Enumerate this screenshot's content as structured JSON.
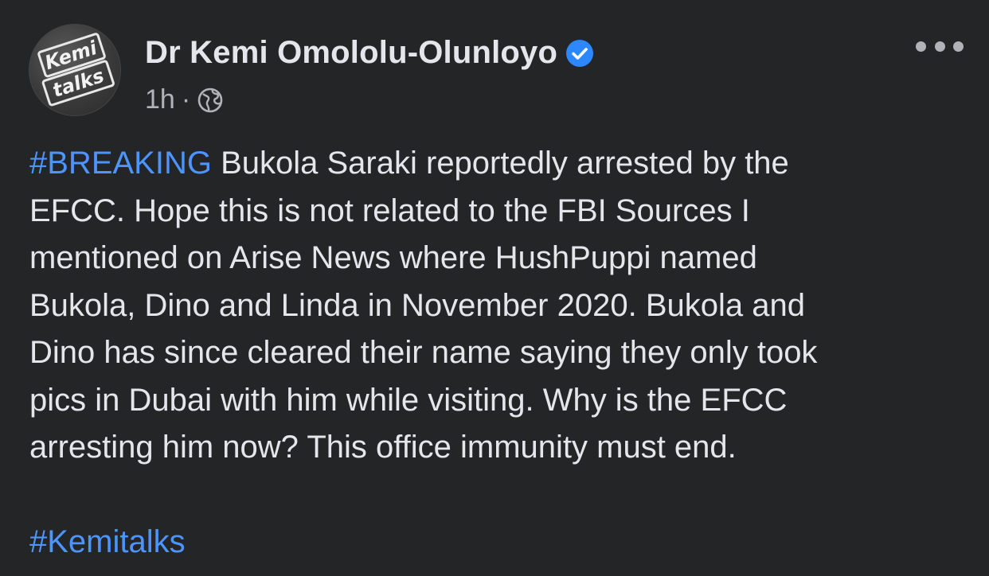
{
  "post": {
    "author": {
      "name": "Dr Kemi Omololu-Olunloyo",
      "verified": true,
      "avatar_text_line1": "Kemi",
      "avatar_text_line2": "talks"
    },
    "timestamp": "1h",
    "separator": "·",
    "audience_icon": "globe-icon",
    "more_icon": "more-options-icon",
    "body": {
      "lines": [
        {
          "hashtag": "#BREAKING",
          "text": " Bukola Saraki reportedly arrested by the"
        },
        {
          "text": "EFCC. Hope this is not related to the FBI Sources I"
        },
        {
          "text": "mentioned on Arise News where HushPuppi named"
        },
        {
          "text": "Bukola, Dino and Linda in November 2020. Bukola and"
        },
        {
          "text": "Dino has since cleared their name saying they only took"
        },
        {
          "text": "pics in Dubai with him while visiting. Why is the EFCC"
        },
        {
          "text": "arresting him now? This office immunity must end."
        }
      ],
      "footer_hashtag": "#Kemitalks"
    }
  },
  "colors": {
    "background": "#242526",
    "text_primary": "#e4e6eb",
    "text_secondary": "#b0b3b8",
    "link": "#4d94ff",
    "verified_badge": "#2d88ff"
  }
}
